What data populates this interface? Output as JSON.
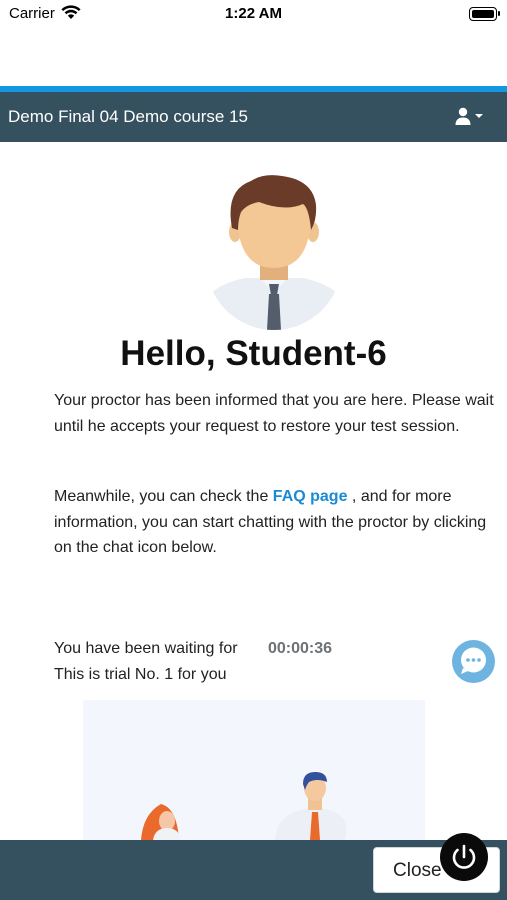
{
  "status_bar": {
    "carrier": "Carrier",
    "time": "1:22 AM"
  },
  "header": {
    "course_title": "Demo Final 04 Demo course 15"
  },
  "greeting": "Hello, Student-6",
  "message_1": "Your proctor has been informed that you are here. Please wait until he accepts your request to restore your test session.",
  "message_2": {
    "before": "Meanwhile, you can check the ",
    "link": "FAQ page",
    "after": " , and for more information, you can start chatting with the proctor by clicking on the chat icon below."
  },
  "waiting": {
    "label": "You have been waiting for",
    "timer": "00:00:36"
  },
  "trial_text": "This is trial No. 1 for you",
  "footer": {
    "close_label": "Close"
  },
  "colors": {
    "header_bg": "#35505f",
    "accent": "#1496e0",
    "link": "#1a8ad6",
    "chat": "#6fb3e0"
  }
}
